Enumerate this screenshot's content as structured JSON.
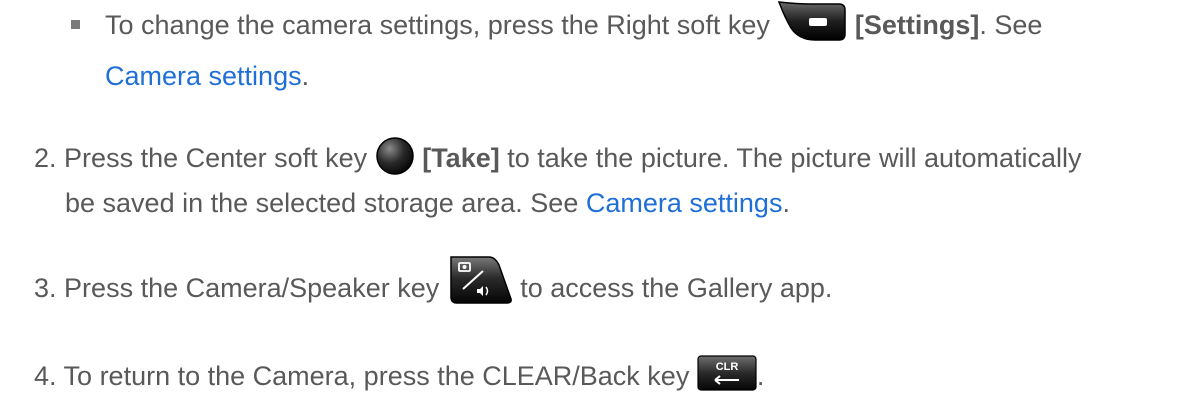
{
  "bullet_item": {
    "text_before": "To change the camera settings, press the Right soft key ",
    "key_label": "[Settings]",
    "text_after": ". See",
    "link": "Camera settings",
    "end": "."
  },
  "steps": [
    {
      "number": "2.",
      "line1_before": "Press the Center soft key ",
      "key_label": "[Take]",
      "line1_after": " to take the picture. The picture will automatically",
      "line2_before": "be saved in the selected storage area. See ",
      "link": "Camera settings",
      "line2_end": "."
    },
    {
      "number": "3.",
      "text_before": "Press the Camera/Speaker key ",
      "text_after": " to access the Gallery app."
    },
    {
      "number": "4.",
      "text_before": "To return to the Camera, press the CLEAR/Back key ",
      "text_after": "."
    }
  ],
  "icons": {
    "right_soft_key": "right-soft-key-icon",
    "center_soft_key": "center-soft-key-icon",
    "camera_speaker_key": "camera-speaker-key-icon",
    "clear_back_key": "clear-back-key-icon",
    "clear_key_text": "CLR"
  }
}
